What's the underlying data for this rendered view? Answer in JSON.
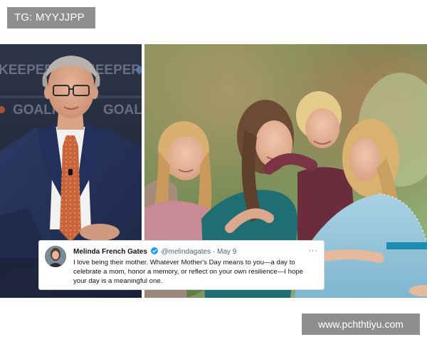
{
  "watermark_top": {
    "label": "TG: MYYJJPP"
  },
  "watermark_bottom": {
    "label": "www.pchthtiyu.com"
  },
  "backdrop_left": {
    "banner_words": [
      "KEEPERS",
      "KEEPERS",
      "GOALKE",
      "GOALKEE"
    ]
  },
  "tweet": {
    "display_name": "Melinda French Gates",
    "verified_icon": "verified-check-icon",
    "handle": "@melindagates",
    "separator": "·",
    "date": "May 9",
    "more_label": "···",
    "body": "I love being their mother. Whatever Mother's Day means to you—a day to celebrate a mom, honor a memory, or reflect on your own resilience—I hope your day is a meaningful one.",
    "accent_color": "#1d9bf0"
  }
}
